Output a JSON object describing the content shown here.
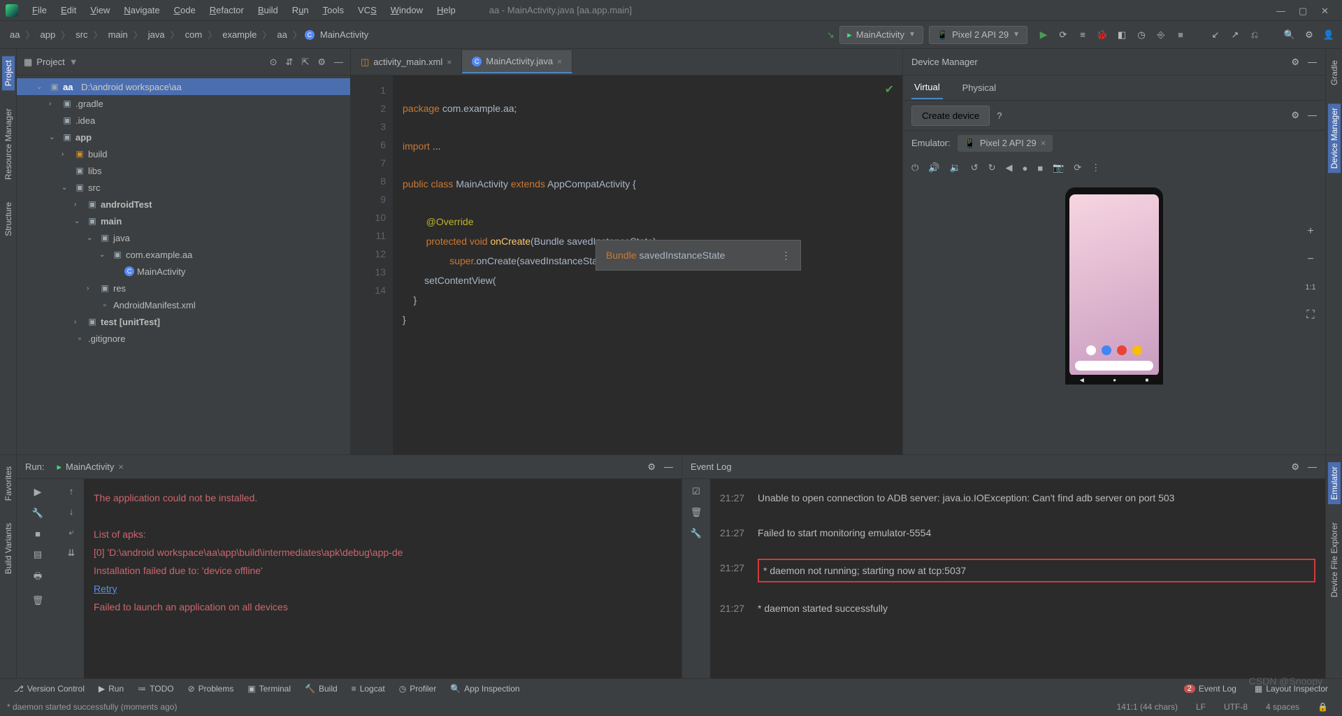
{
  "window": {
    "title": "aa - MainActivity.java [aa.app.main]"
  },
  "menu": [
    "File",
    "Edit",
    "View",
    "Navigate",
    "Code",
    "Refactor",
    "Build",
    "Run",
    "Tools",
    "VCS",
    "Window",
    "Help"
  ],
  "breadcrumb": [
    "aa",
    "app",
    "src",
    "main",
    "java",
    "com",
    "example",
    "aa",
    "MainActivity"
  ],
  "runcfg": {
    "config": "MainActivity",
    "device": "Pixel 2 API 29"
  },
  "project": {
    "title": "Project",
    "root": "aa",
    "rootPath": "D:\\android workspace\\aa",
    "items": [
      {
        "label": ".gradle",
        "indent": 2,
        "arrow": "›",
        "icon": "folder-b"
      },
      {
        "label": ".idea",
        "indent": 2,
        "arrow": "",
        "icon": "folder-b"
      },
      {
        "label": "app",
        "indent": 2,
        "arrow": "⌄",
        "icon": "folder-b",
        "bold": true
      },
      {
        "label": "build",
        "indent": 3,
        "arrow": "›",
        "icon": "folder-o"
      },
      {
        "label": "libs",
        "indent": 3,
        "arrow": "",
        "icon": "folder-b"
      },
      {
        "label": "src",
        "indent": 3,
        "arrow": "⌄",
        "icon": "folder-b"
      },
      {
        "label": "androidTest",
        "indent": 4,
        "arrow": "›",
        "icon": "folder-b",
        "bold": true
      },
      {
        "label": "main",
        "indent": 4,
        "arrow": "⌄",
        "icon": "folder-b",
        "bold": true
      },
      {
        "label": "java",
        "indent": 5,
        "arrow": "⌄",
        "icon": "folder-b"
      },
      {
        "label": "com.example.aa",
        "indent": 6,
        "arrow": "⌄",
        "icon": "folder-b"
      },
      {
        "label": "MainActivity",
        "indent": 7,
        "arrow": "",
        "icon": "class"
      },
      {
        "label": "res",
        "indent": 5,
        "arrow": "›",
        "icon": "folder-b"
      },
      {
        "label": "AndroidManifest.xml",
        "indent": 5,
        "arrow": "",
        "icon": "file"
      },
      {
        "label": "test [unitTest]",
        "indent": 4,
        "arrow": "›",
        "icon": "folder-b",
        "bold": true
      },
      {
        "label": ".gitignore",
        "indent": 3,
        "arrow": "",
        "icon": "file"
      }
    ]
  },
  "tabs": [
    {
      "label": "activity_main.xml",
      "active": false
    },
    {
      "label": "MainActivity.java",
      "active": true
    }
  ],
  "code": {
    "lines": [
      "1",
      "2",
      "3",
      "6",
      "7",
      "8",
      "9",
      "10",
      "11",
      "12",
      "13",
      "14"
    ],
    "l1": {
      "kw": "package",
      "rest": " com.example.aa;"
    },
    "l3": {
      "kw": "import",
      "rest": " ..."
    },
    "l7": {
      "kw1": "public class",
      "cls": " MainActivity ",
      "kw2": "extends",
      "ext": " AppCompatActivity {"
    },
    "l9": "@Override",
    "l10": {
      "kw": "protected void ",
      "fn": "onCreate",
      "rest": "(Bundle savedInstanceState)"
    },
    "l11": {
      "kw": "super",
      "rest": ".onCreate(savedInstanceState);"
    },
    "l12": "        setContentView(",
    "l13": "    }",
    "l14": "}",
    "hint": {
      "type": "Bundle",
      "name": "savedInstanceState"
    }
  },
  "devmgr": {
    "title": "Device Manager",
    "tabs": [
      "Virtual",
      "Physical"
    ],
    "create": "Create device",
    "emulabel": "Emulator:",
    "emutab": "Pixel 2 API 29"
  },
  "run": {
    "title": "Run:",
    "tab": "MainActivity",
    "l1": "The application could not be installed.",
    "l2": "List of apks:",
    "l3": "[0] 'D:\\android workspace\\aa\\app\\build\\intermediates\\apk\\debug\\app-de",
    "l4": "Installation failed due to: 'device offline'",
    "l5": "Retry",
    "l6": "Failed to launch an application on all devices"
  },
  "eventlog": {
    "title": "Event Log",
    "rows": [
      {
        "time": "21:27",
        "msg": "Unable to open connection to ADB server: java.io.IOException: Can't find adb server on port 503"
      },
      {
        "time": "21:27",
        "msg": "Failed to start monitoring emulator-5554"
      },
      {
        "time": "21:27",
        "msg": "* daemon not running; starting now at tcp:5037",
        "hl": true
      },
      {
        "time": "21:27",
        "msg": "* daemon started successfully"
      }
    ]
  },
  "bottombar": {
    "items": [
      "Version Control",
      "Run",
      "TODO",
      "Problems",
      "Terminal",
      "Build",
      "Logcat",
      "Profiler",
      "App Inspection"
    ],
    "eventlog": "Event Log",
    "badge": "2",
    "layout": "Layout Inspector"
  },
  "status": {
    "msg": "* daemon started successfully (moments ago)",
    "pos": "141:1 (44 chars)",
    "lf": "LF",
    "enc": "UTF-8",
    "spaces": "4 spaces"
  },
  "strips": {
    "project": "Project",
    "resmgr": "Resource Manager",
    "structure": "Structure",
    "favorites": "Favorites",
    "buildvar": "Build Variants",
    "gradle": "Gradle",
    "devmgr": "Device Manager",
    "emulator": "Emulator",
    "devexp": "Device File Explorer"
  },
  "watermark": "CSDN @Snoopy"
}
